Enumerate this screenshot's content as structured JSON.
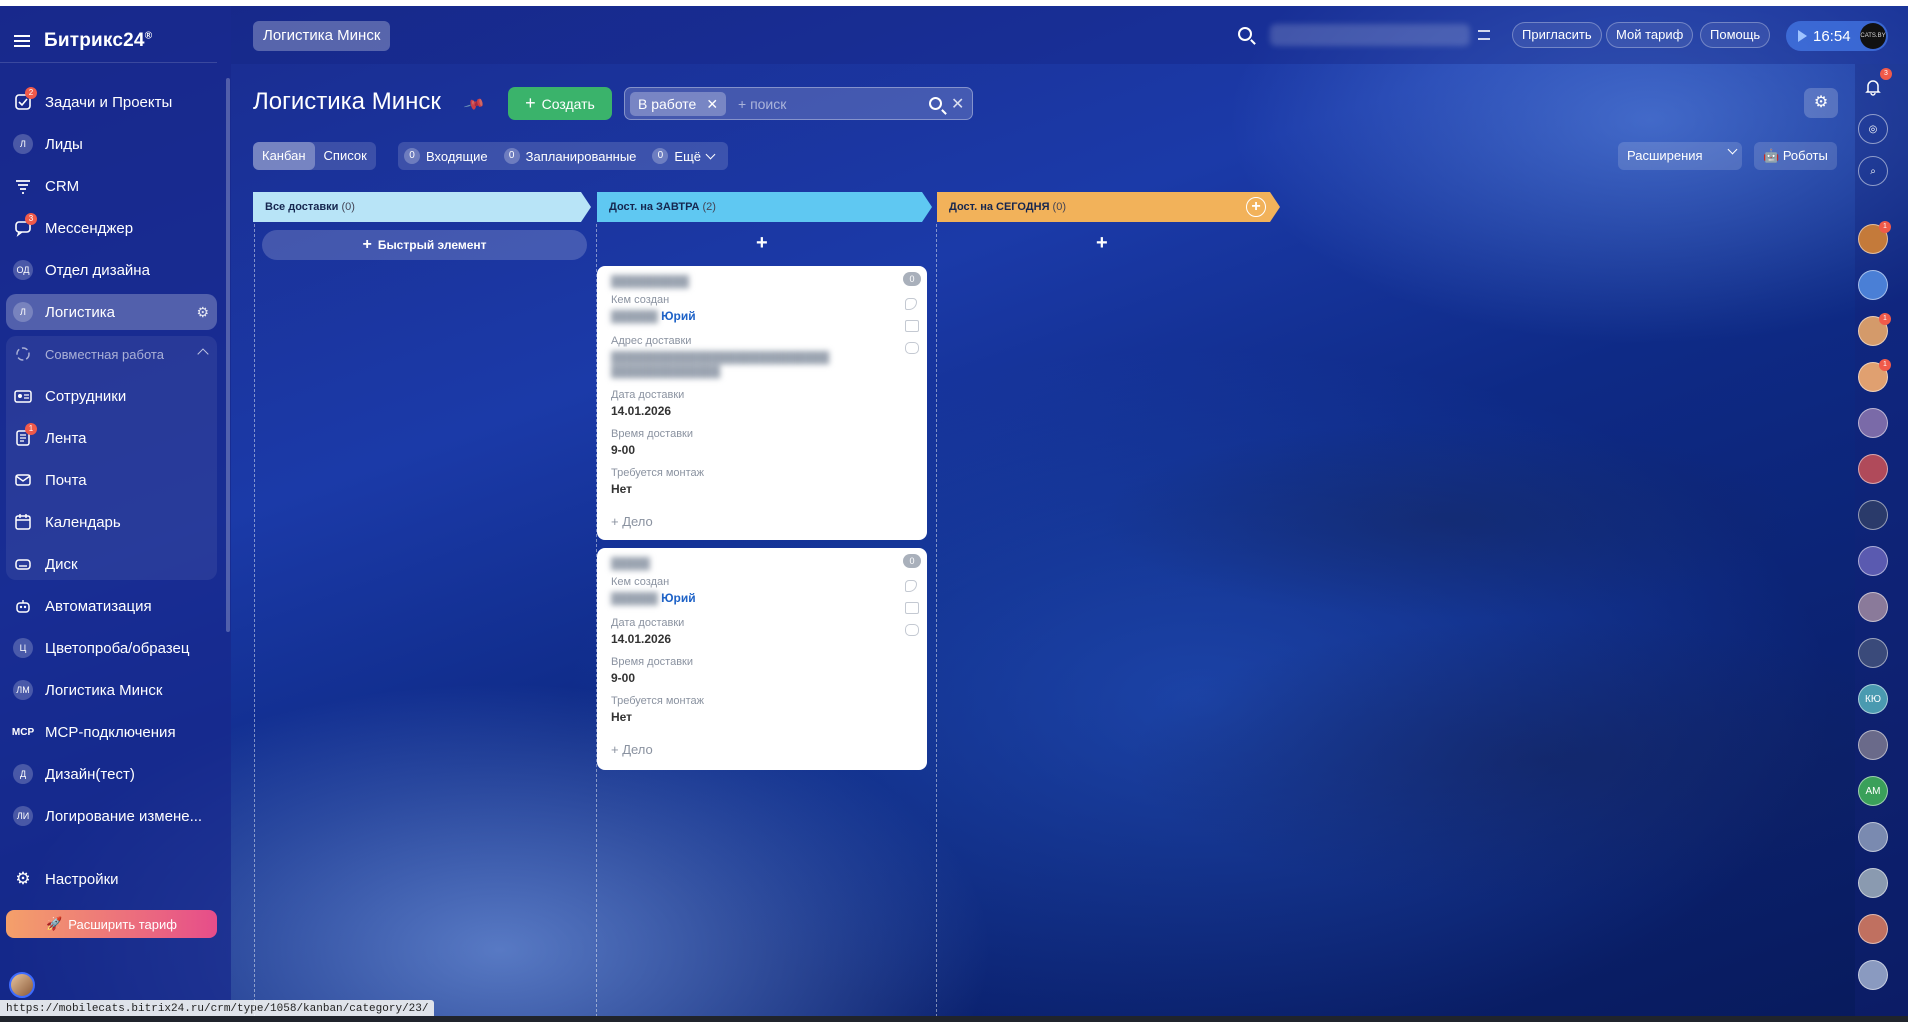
{
  "app": {
    "brand": "Битрикс24",
    "brand_mark": "®"
  },
  "sidebar": {
    "items": [
      {
        "name": "sidebar-item-tasks",
        "label": "Задачи и Проекты",
        "icon": "checkbox-icon",
        "badge": "2"
      },
      {
        "name": "sidebar-item-leads",
        "label": "Лиды",
        "icon_text": "Л"
      },
      {
        "name": "sidebar-item-crm",
        "label": "CRM",
        "icon": "funnel-icon"
      },
      {
        "name": "sidebar-item-messenger",
        "label": "Мессенджер",
        "icon": "chat-icon",
        "badge": "3"
      },
      {
        "name": "sidebar-item-design-dept",
        "label": "Отдел дизайна",
        "icon_text": "ОД"
      },
      {
        "name": "sidebar-item-logistics",
        "label": "Логистика",
        "icon_text": "Л",
        "active": true
      },
      {
        "name": "sidebar-item-collab",
        "label": "Совместная работа",
        "icon": "share-icon"
      },
      {
        "name": "sidebar-item-employees",
        "label": "Сотрудники",
        "icon": "id-card-icon"
      },
      {
        "name": "sidebar-item-feed",
        "label": "Лента",
        "icon": "feed-icon",
        "badge": "1"
      },
      {
        "name": "sidebar-item-mail",
        "label": "Почта",
        "icon": "mail-icon"
      },
      {
        "name": "sidebar-item-calendar",
        "label": "Календарь",
        "icon": "calendar-icon"
      },
      {
        "name": "sidebar-item-disk",
        "label": "Диск",
        "icon": "disk-icon"
      },
      {
        "name": "sidebar-item-automation",
        "label": "Автоматизация",
        "icon": "robot-icon"
      },
      {
        "name": "sidebar-item-color-proof",
        "label": "Цветопроба/образец",
        "icon_text": "Ц"
      },
      {
        "name": "sidebar-item-logistics-minsk",
        "label": "Логистика Минск",
        "icon_text": "ЛМ"
      },
      {
        "name": "sidebar-item-mcp",
        "label": "MCP-подключения",
        "icon_text": "MCP"
      },
      {
        "name": "sidebar-item-design-test",
        "label": "Дизайн(тест)",
        "icon_text": "Д"
      },
      {
        "name": "sidebar-item-change-log",
        "label": "Логирование измене...",
        "icon_text": "ЛИ"
      }
    ],
    "settings_label": "Настройки",
    "upgrade_label": "Расширить тариф"
  },
  "status_url": "https://mobilecats.bitrix24.ru/crm/type/1058/kanban/category/23/",
  "topbar": {
    "crumb": "Логистика Минск",
    "invite": "Пригласить",
    "my_plan": "Мой тариф",
    "help": "Помощь",
    "time": "16:54",
    "logo_text": "CATS.BY"
  },
  "header": {
    "title": "Логистика Минск",
    "create_label": "Создать",
    "filter_chip": "В работе",
    "search_placeholder": "+ поиск"
  },
  "views": {
    "kanban": "Канбан",
    "list": "Список",
    "incoming_count": "0",
    "incoming": "Входящие",
    "planned_count": "0",
    "planned": "Запланированные",
    "more_count": "0",
    "more": "Ещё",
    "extensions": "Расширения",
    "robots": "Роботы"
  },
  "columns": [
    {
      "title": "Все доставки",
      "count": "(0)",
      "color": "#b8e4f7"
    },
    {
      "title": "Дост. на ЗАВТРА",
      "count": "(2)",
      "color": "#5fc8f2"
    },
    {
      "title": "Дост. на СЕГОДНЯ",
      "count": "(0)",
      "color": "#f2b25a"
    }
  ],
  "quick_add": "Быстрый элемент",
  "cards": [
    {
      "count": "0",
      "author_label": "Кем создан",
      "author": "Юрий",
      "address_label": "Адрес доставки",
      "date_label": "Дата доставки",
      "date": "14.01.2026",
      "time_label": "Время доставки",
      "time": "9-00",
      "mount_label": "Требуется монтаж",
      "mount": "Нет",
      "action": "+ Дело"
    },
    {
      "count": "0",
      "author_label": "Кем создан",
      "author": "Юрий",
      "date_label": "Дата доставки",
      "date": "14.01.2026",
      "time_label": "Время доставки",
      "time": "9-00",
      "mount_label": "Требуется монтаж",
      "mount": "Нет",
      "action": "+ Дело"
    }
  ],
  "rail": {
    "notifications_badge": "3",
    "avatars": [
      "1",
      "",
      "1",
      "1",
      "",
      "",
      "",
      "",
      "",
      "",
      "КЮ",
      "",
      "АМ",
      "",
      "",
      "",
      ""
    ]
  }
}
